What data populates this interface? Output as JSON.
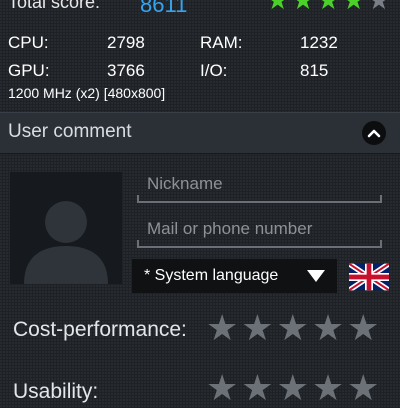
{
  "score": {
    "label": "Total score:",
    "value": "8611",
    "stars_filled": 4,
    "stars_total": 5
  },
  "specs": {
    "cpu_label": "CPU:",
    "cpu_value": "2798",
    "ram_label": "RAM:",
    "ram_value": "1232",
    "gpu_label": "GPU:",
    "gpu_value": "3766",
    "io_label": "I/O:",
    "io_value": "815",
    "cpu_info": "1200 MHz (x2) [480x800]"
  },
  "comment": {
    "title": "User comment",
    "nickname_placeholder": "Nickname",
    "mail_placeholder": "Mail or phone number",
    "language_selected": "* System language"
  },
  "ratings": {
    "cost_label": "Cost-performance:",
    "usability_label": "Usability:",
    "cost_stars": 0,
    "usability_stars": 0
  },
  "colors": {
    "accent": "#35a4f0",
    "star_on": "#4cd12a",
    "star_off": "#6c7178"
  },
  "icons": {
    "collapse": "chevron-up-icon",
    "language_flag": "uk-flag-icon",
    "dropdown": "triangle-down-icon"
  }
}
